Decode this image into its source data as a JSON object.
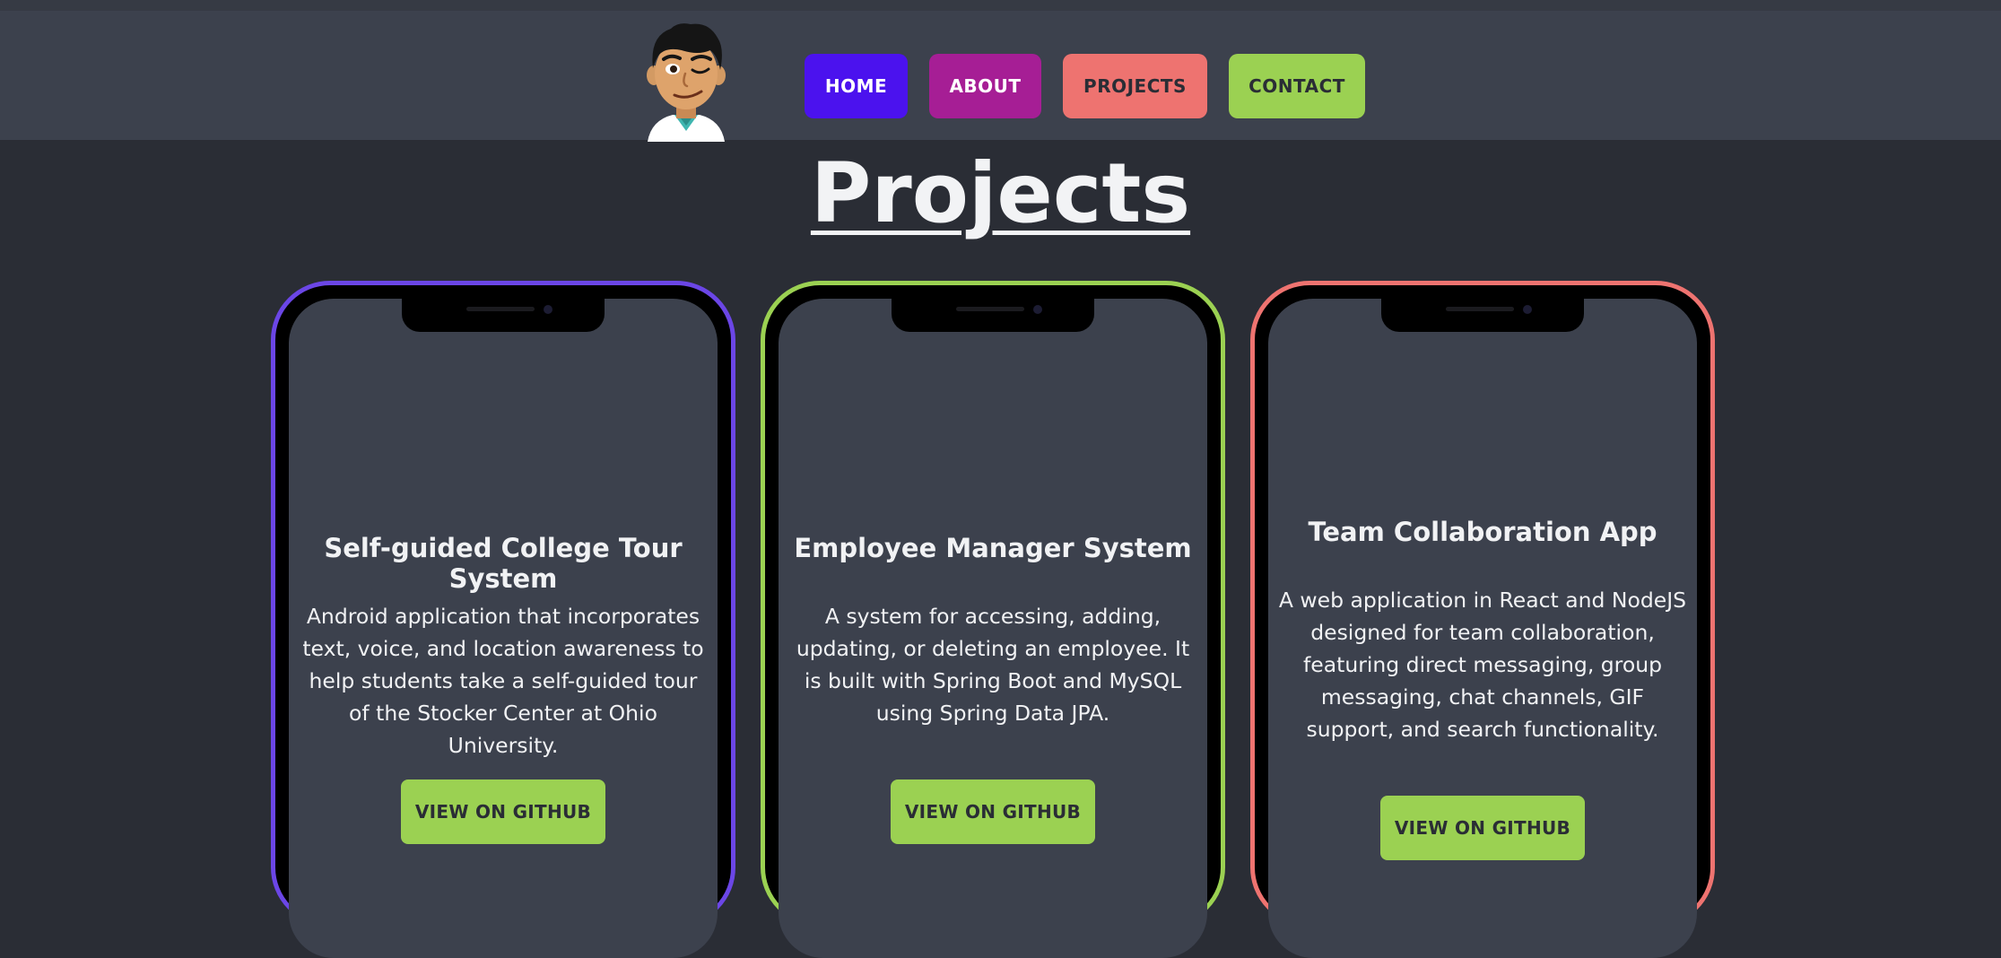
{
  "nav": {
    "items": [
      {
        "label": "HOME",
        "bg": "#4b12ee",
        "fg": "#ffffff"
      },
      {
        "label": "ABOUT",
        "bg": "#a61e95",
        "fg": "#ffffff"
      },
      {
        "label": "PROJECTS",
        "bg": "#ee7370",
        "fg": "#2a2d35"
      },
      {
        "label": "CONTACT",
        "bg": "#9bd152",
        "fg": "#2a2d35"
      }
    ]
  },
  "page": {
    "title": "Projects"
  },
  "projects": [
    {
      "title": "Self-guided College Tour System",
      "description": "Android application that incorporates text, voice, and location awareness to help students take a self-guided tour of the Stocker Center at Ohio University.",
      "button_label": "VIEW ON GITHUB",
      "border_color": "#6b46e6"
    },
    {
      "title": "Employee Manager System",
      "description": "A system for accessing, adding, updating, or deleting an employee. It is built with Spring Boot and MySQL using Spring Data JPA.",
      "button_label": "VIEW ON GITHUB",
      "border_color": "#9bd152"
    },
    {
      "title": "Team Collaboration App",
      "description": "A web application in React and NodeJS designed for team collaboration, featuring direct messaging, group messaging, chat channels, GIF support, and search functionality.",
      "button_label": "VIEW ON GITHUB",
      "border_color": "#ee7370"
    }
  ]
}
